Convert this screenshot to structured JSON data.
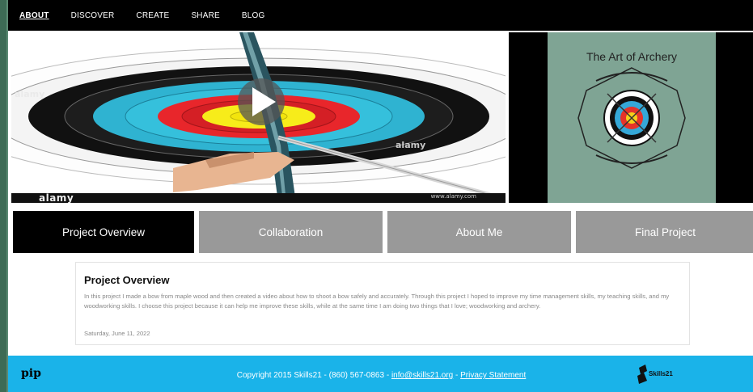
{
  "nav": {
    "items": [
      {
        "label": "ABOUT",
        "active": true
      },
      {
        "label": "DISCOVER",
        "active": false
      },
      {
        "label": "CREATE",
        "active": false
      },
      {
        "label": "SHARE",
        "active": false
      },
      {
        "label": "BLOG",
        "active": false
      }
    ]
  },
  "hero": {
    "video": {
      "watermark": "alamy",
      "bar_logo": "alamy",
      "bar_info": "www.alamy.com"
    },
    "poster": {
      "title": "The Art of Archery"
    }
  },
  "tabs": [
    {
      "label": "Project Overview",
      "active": true
    },
    {
      "label": "Collaboration",
      "active": false
    },
    {
      "label": "About Me",
      "active": false
    },
    {
      "label": "Final Project",
      "active": false
    }
  ],
  "card": {
    "title": "Project Overview",
    "body": "In this project I made a bow from maple wood and then created a video about how to shoot a bow safely and accurately. Through this project I hoped to improve my time management skills, my teaching skills, and my woodworking skills. I choose this project because it can help me improve these skills, while at the same time I am doing two things that I love; woodworking and archery.",
    "date": "Saturday, June 11, 2022"
  },
  "footer": {
    "left_logo": "pip",
    "copyright": "Copyright 2015 Skills21 - (860) 567-0863 - ",
    "email": "info@skills21.org",
    "separator": " - ",
    "privacy": "Privacy Statement",
    "right_logo": "Skills21"
  },
  "colors": {
    "nav_bg": "#000000",
    "tab_active": "#000000",
    "tab_inactive": "#999999",
    "footer_bg": "#1ab3e9",
    "frame": "#3d6b55"
  }
}
